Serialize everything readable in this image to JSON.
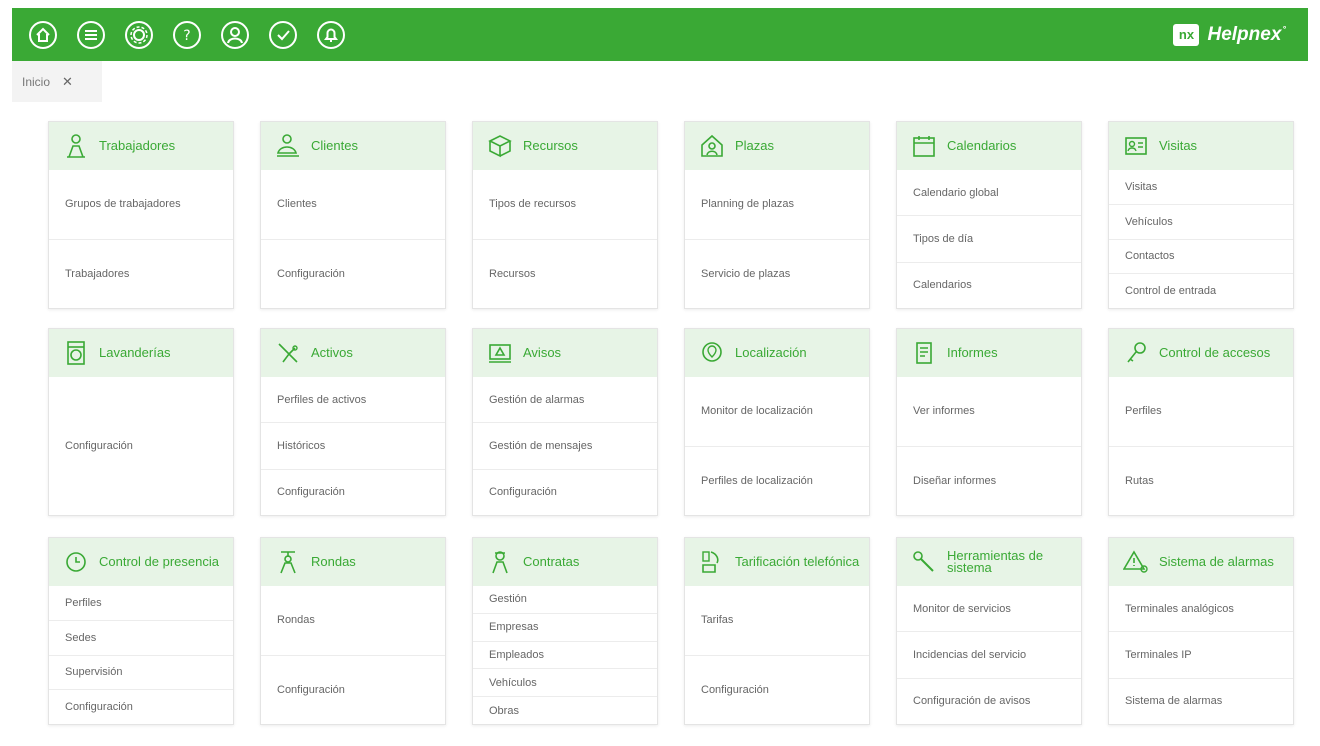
{
  "header": {
    "brand": "Helpnex",
    "logo_mark": "nx",
    "registered": "°",
    "icons": [
      "home-icon",
      "menu-icon",
      "settings-icon",
      "help-icon",
      "user-icon",
      "check-icon",
      "bell-icon"
    ]
  },
  "tab": {
    "label": "Inicio",
    "close": "✕"
  },
  "cards": [
    {
      "title": "Trabajadores",
      "icon": "worker-icon",
      "items": [
        "Grupos de trabajadores",
        "Trabajadores"
      ]
    },
    {
      "title": "Clientes",
      "icon": "clients-icon",
      "items": [
        "Clientes",
        "Configuración"
      ]
    },
    {
      "title": "Recursos",
      "icon": "resources-icon",
      "items": [
        "Tipos de recursos",
        "Recursos"
      ]
    },
    {
      "title": "Plazas",
      "icon": "places-icon",
      "items": [
        "Planning de plazas",
        "Servicio de plazas"
      ]
    },
    {
      "title": "Calendarios",
      "icon": "calendar-icon",
      "items": [
        "Calendario global",
        "Tipos de día",
        "Calendarios"
      ]
    },
    {
      "title": "Visitas",
      "icon": "visits-icon",
      "items": [
        "Visitas",
        "Vehículos",
        "Contactos",
        "Control de entrada"
      ]
    },
    {
      "title": "Lavanderías",
      "icon": "laundry-icon",
      "items": [
        "Configuración"
      ]
    },
    {
      "title": "Activos",
      "icon": "assets-icon",
      "items": [
        "Perfiles de activos",
        "Históricos",
        "Configuración"
      ]
    },
    {
      "title": "Avisos",
      "icon": "alerts-icon",
      "items": [
        "Gestión de alarmas",
        "Gestión de mensajes",
        "Configuración"
      ]
    },
    {
      "title": "Localización",
      "icon": "location-icon",
      "items": [
        "Monitor de localización",
        "Perfiles de localización"
      ]
    },
    {
      "title": "Informes",
      "icon": "reports-icon",
      "items": [
        "Ver informes",
        "Diseñar informes"
      ]
    },
    {
      "title": "Control de accesos",
      "icon": "key-icon",
      "items": [
        "Perfiles",
        "Rutas"
      ]
    },
    {
      "title": "Control de presencia",
      "icon": "clock-icon",
      "items": [
        "Perfiles",
        "Sedes",
        "Supervisión",
        "Configuración"
      ]
    },
    {
      "title": "Rondas",
      "icon": "guard-icon",
      "items": [
        "Rondas",
        "Configuración"
      ]
    },
    {
      "title": "Contratas",
      "icon": "contractor-icon",
      "items": [
        "Gestión",
        "Empresas",
        "Empleados",
        "Vehículos",
        "Obras"
      ]
    },
    {
      "title": "Tarificación telefónica",
      "icon": "phone-icon",
      "items": [
        "Tarifas",
        "Configuración"
      ]
    },
    {
      "title": "Herramientas de sistema",
      "icon": "tools-icon",
      "items": [
        "Monitor de servicios",
        "Incidencias del servicio",
        "Configuración de avisos"
      ]
    },
    {
      "title": "Sistema de alarmas",
      "icon": "alarm-icon",
      "items": [
        "Terminales analógicos",
        "Terminales IP",
        "Sistema de alarmas"
      ]
    }
  ],
  "colors": {
    "primary": "#3aa935",
    "card_header": "#e7f4e6"
  }
}
